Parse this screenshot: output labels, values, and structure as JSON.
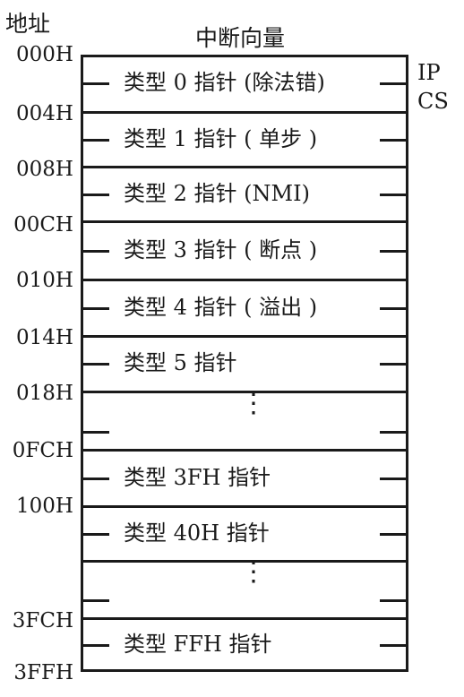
{
  "header": {
    "address_title": "地址",
    "column_title": "中断向量"
  },
  "side_labels": [
    "IP",
    "CS"
  ],
  "addresses": [
    "000H",
    "004H",
    "008H",
    "00CH",
    "010H",
    "014H",
    "018H",
    "0FCH",
    "100H",
    "3FCH",
    "3FFH"
  ],
  "slots": [
    {
      "label": "类型 0 指针 (除法错)"
    },
    {
      "label": "类型 1 指针 ( 单步 )"
    },
    {
      "label": "类型 2 指针 (NMI)"
    },
    {
      "label": "类型 3 指针 ( 断点 )"
    },
    {
      "label": "类型 4 指针 ( 溢出 )"
    },
    {
      "label": "类型 5 指针"
    },
    {
      "label": ""
    },
    {
      "label": "类型 3FH 指针"
    },
    {
      "label": "类型 40H 指针"
    },
    {
      "label": ""
    },
    {
      "label": "类型 FFH 指针"
    }
  ],
  "ellipsis": "⋮"
}
